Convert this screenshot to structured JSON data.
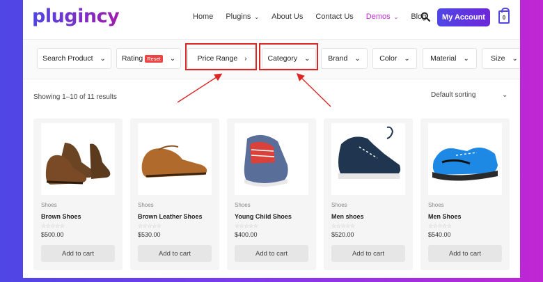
{
  "brand": {
    "logo_text": "plugincy",
    "accent": "#4f46e5"
  },
  "nav": {
    "items": [
      {
        "label": "Home",
        "has_caret": false
      },
      {
        "label": "Plugins",
        "has_caret": true
      },
      {
        "label": "About Us",
        "has_caret": false
      },
      {
        "label": "Contact Us",
        "has_caret": false
      },
      {
        "label": "Demos",
        "has_caret": true,
        "active": true
      },
      {
        "label": "Blog",
        "has_caret": false
      }
    ],
    "search_icon": "search-icon",
    "account_button": "My Account",
    "cart_count": "0"
  },
  "filters": {
    "items": [
      {
        "label": "Search Product",
        "icon": "chevron-down-icon"
      },
      {
        "label": "Rating",
        "badge": "Reset",
        "icon": "chevron-down-icon"
      },
      {
        "label": "Price Range",
        "icon": "chevron-right-icon",
        "highlighted": true
      },
      {
        "label": "Category",
        "icon": "chevron-down-icon",
        "highlighted": true
      },
      {
        "label": "Brand",
        "icon": "chevron-down-icon"
      },
      {
        "label": "Color",
        "icon": "chevron-down-icon"
      },
      {
        "label": "Material",
        "icon": "chevron-down-icon"
      },
      {
        "label": "Size",
        "icon": "chevron-down-icon"
      }
    ],
    "highlight_color": "#dc2626"
  },
  "results": {
    "count_text": "Showing 1–10 of 11 results",
    "sort_selected": "Default sorting"
  },
  "products": [
    {
      "category": "Shoes",
      "title": "Brown Shoes",
      "price": "$500.00",
      "button": "Add to cart",
      "rating": 0
    },
    {
      "category": "Shoes",
      "title": "Brown Leather Shoes",
      "price": "$530.00",
      "button": "Add to cart",
      "rating": 0
    },
    {
      "category": "Shoes",
      "title": "Young Child Shoes",
      "price": "$400.00",
      "button": "Add to cart",
      "rating": 0
    },
    {
      "category": "Shoes",
      "title": "Men shoes",
      "price": "$520.00",
      "button": "Add to cart",
      "rating": 0
    },
    {
      "category": "Shoes",
      "title": "Men Shoes",
      "price": "$540.00",
      "button": "Add to cart",
      "rating": 0
    }
  ]
}
